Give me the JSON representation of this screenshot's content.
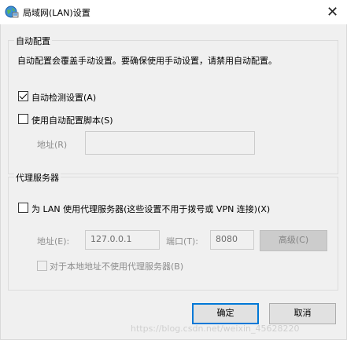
{
  "window": {
    "title": "局域网(LAN)设置",
    "close_glyph": "✕"
  },
  "auto_config": {
    "group_title": "自动配置",
    "description": "自动配置会覆盖手动设置。要确保使用手动设置，请禁用自动配置。",
    "auto_detect_label": "自动检测设置(A)",
    "auto_detect_checked": true,
    "use_script_label": "使用自动配置脚本(S)",
    "use_script_checked": false,
    "address_label": "地址(R)",
    "address_value": ""
  },
  "proxy": {
    "group_title": "代理服务器",
    "use_proxy_label": "为 LAN 使用代理服务器(这些设置不用于拨号或 VPN 连接)(X)",
    "use_proxy_checked": false,
    "address_label": "地址(E):",
    "address_value": "127.0.0.1",
    "port_label": "端口(T):",
    "port_value": "8080",
    "advanced_label": "高级(C)",
    "bypass_local_label": "对于本地地址不使用代理服务器(B)",
    "bypass_local_checked": false
  },
  "footer": {
    "ok_label": "确定",
    "cancel_label": "取消"
  },
  "watermark": "https://blog.csdn.net/weixin_45628220"
}
